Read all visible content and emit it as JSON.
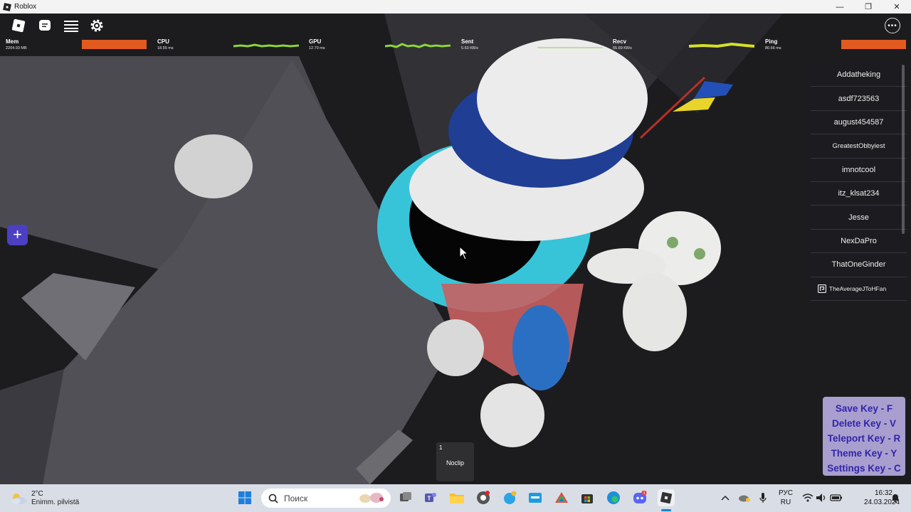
{
  "window": {
    "title": "Roblox",
    "minimize_glyph": "—",
    "restore_glyph": "❐",
    "close_glyph": "✕"
  },
  "topbar": {
    "icons": [
      "roblox-logo-icon",
      "chat-icon",
      "menu-icon",
      "settings-icon"
    ],
    "more_glyph": "•••"
  },
  "stats": {
    "mem": {
      "label": "Mem",
      "value": "2204.93 MB"
    },
    "cpu": {
      "label": "CPU",
      "value": "18.55 ms"
    },
    "gpu": {
      "label": "GPU",
      "value": "12.70 ms"
    },
    "sent": {
      "label": "Sent",
      "value": "5.63 KB/s"
    },
    "recv": {
      "label": "Recv",
      "value": "55.69 KB/s"
    },
    "ping": {
      "label": "Ping",
      "value": "80.66 ms"
    },
    "colors": {
      "orange": "#e35a1f",
      "green": "#8ed43a",
      "yellow": "#d6e02a"
    }
  },
  "players": [
    "Addatheking",
    "asdf723563",
    "august454587",
    "GreatestObbyiest",
    "imnotcool",
    "itz_klsat234",
    "Jesse",
    "NexDaPro",
    "ThatOneGinder",
    "TheAverageJToHFan"
  ],
  "plus_glyph": "+",
  "keybinds": [
    "Save Key - F",
    "Delete Key - V",
    "Teleport Key - R",
    "Theme Key - Y",
    "Settings Key - C"
  ],
  "noclip": {
    "number": "1",
    "label": "Noclip"
  },
  "taskbar": {
    "weather_temp": "2°C",
    "weather_desc": "Enimm. pilvistä",
    "search_placeholder": "Поиск",
    "lang_top": "РУС",
    "lang_bottom": "RU",
    "time": "16:32",
    "date": "24.03.2024",
    "discord_badge": "3"
  }
}
